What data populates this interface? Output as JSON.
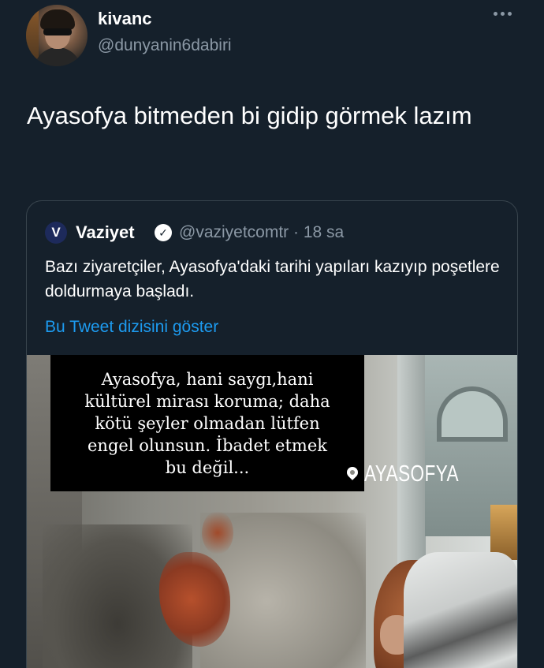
{
  "tweet": {
    "author_name": "kivanc",
    "author_handle": "@dunyanin6dabiri",
    "text": "Ayasofya bitmeden bi gidip görmek lazım",
    "more_icon": "more-dots-icon"
  },
  "quoted_tweet": {
    "logo_letter": "V",
    "author_name": "Vaziyet",
    "verified_icon": "verified-badge-icon",
    "handle_and_time": "@vaziyetcomtr · 18 sa",
    "text": "Bazı ziyaretçiler, Ayasofya'daki tarihi yapıları kazıyıp poşetlere doldurmaya başladı.",
    "show_thread_link": "Bu Tweet dizisini göster",
    "media": {
      "caption": "Ayasofya, hani saygı,hani\nkültürel mirası koruma; daha\nkötü şeyler olmadan lütfen\nengel olunsun. İbadet etmek\nbu değil...",
      "location_sticker": "AYASOFYA",
      "location_icon": "location-pin-icon"
    }
  },
  "colors": {
    "background": "#15202b",
    "secondary_text": "#8b98a5",
    "link": "#1d9bf0",
    "border": "#38444d"
  }
}
